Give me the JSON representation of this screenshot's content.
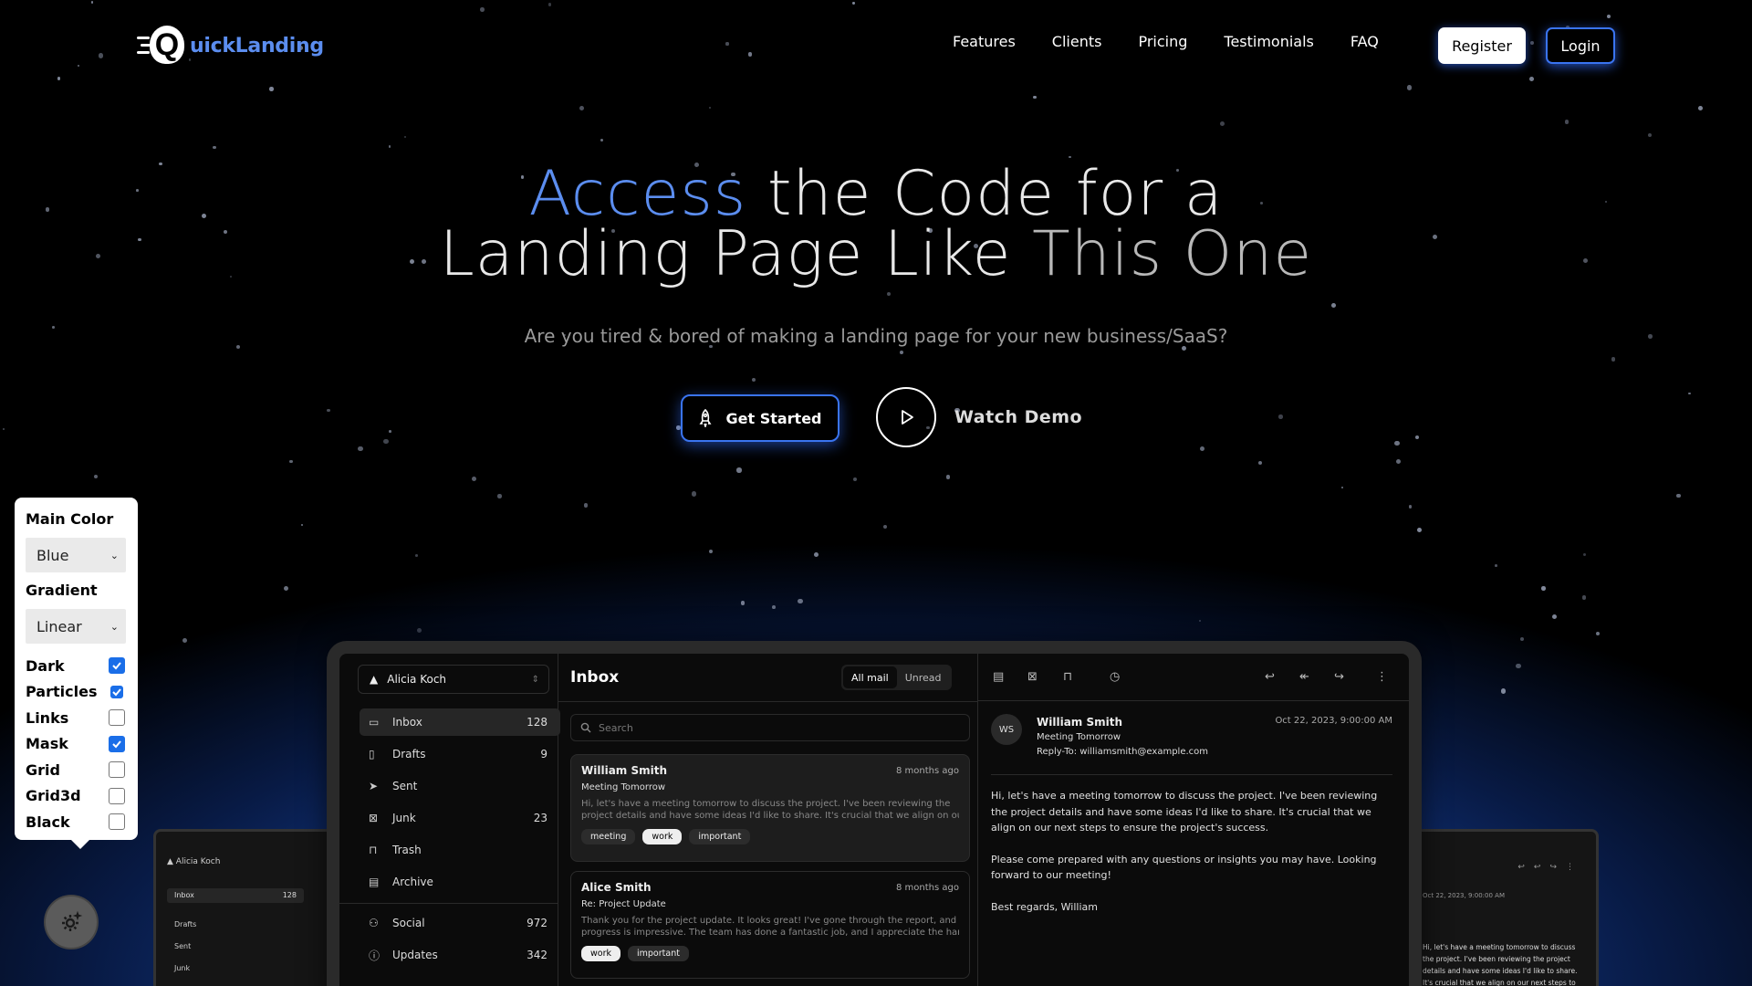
{
  "brand": {
    "logo_letter": "Q",
    "name": "uickLanding",
    "accent": "#5b8def"
  },
  "nav": {
    "links": [
      "Features",
      "Clients",
      "Pricing",
      "Testimonials",
      "FAQ"
    ],
    "register": "Register",
    "login": "Login"
  },
  "hero": {
    "title_accent": "Access",
    "title_rest_1": " the Code for a",
    "title_line2_a": "Landing Page Like ",
    "title_line2_b": "This One",
    "subtitle": "Are you tired & bored of making a landing page for your new business/SaaS?",
    "cta_primary": "Get Started",
    "cta_secondary": "Watch Demo"
  },
  "settings": {
    "main_color_label": "Main Color",
    "main_color_value": "Blue",
    "gradient_label": "Gradient",
    "gradient_value": "Linear",
    "options": [
      {
        "label": "Dark",
        "checked": true
      },
      {
        "label": "Particles",
        "checked": true
      },
      {
        "label": "Links",
        "checked": false
      },
      {
        "label": "Mask",
        "checked": true
      },
      {
        "label": "Grid",
        "checked": false
      },
      {
        "label": "Grid3d",
        "checked": false
      },
      {
        "label": "Black",
        "checked": false
      }
    ],
    "gear_icon": "gear-sparkle-icon"
  },
  "mockup": {
    "account": "Alicia Koch",
    "folders": [
      {
        "label": "Inbox",
        "count": "128",
        "icon": "inbox-icon"
      },
      {
        "label": "Drafts",
        "count": "9",
        "icon": "file-icon"
      },
      {
        "label": "Sent",
        "count": "",
        "icon": "send-icon"
      },
      {
        "label": "Junk",
        "count": "23",
        "icon": "archive-x-icon"
      },
      {
        "label": "Trash",
        "count": "",
        "icon": "trash-icon"
      },
      {
        "label": "Archive",
        "count": "",
        "icon": "archive-icon"
      },
      {
        "label": "Social",
        "count": "972",
        "icon": "users-icon"
      },
      {
        "label": "Updates",
        "count": "342",
        "icon": "alert-circle-icon"
      }
    ],
    "inbox_title": "Inbox",
    "tabs": [
      "All mail",
      "Unread"
    ],
    "search_placeholder": "Search",
    "mails": [
      {
        "from": "William Smith",
        "ago": "8 months ago",
        "subject": "Meeting Tomorrow",
        "preview1": "Hi, let's have a meeting tomorrow to discuss the project. I've been reviewing the",
        "preview2": "project details and have some ideas I'd like to share. It's crucial that we align on our...",
        "labels": [
          "meeting",
          "work",
          "important"
        ]
      },
      {
        "from": "Alice Smith",
        "ago": "8 months ago",
        "subject": "Re: Project Update",
        "preview1": "Thank you for the project update. It looks great! I've gone through the report, and the",
        "preview2": "progress is impressive. The team has done a fantastic job, and I appreciate the hard...",
        "labels": [
          "work",
          "important"
        ]
      }
    ],
    "message": {
      "initials": "WS",
      "from": "William Smith",
      "subject": "Meeting Tomorrow",
      "reply_to": "Reply-To: williamsmith@example.com",
      "date": "Oct 22, 2023, 9:00:00 AM",
      "p1": "Hi, let's have a meeting tomorrow to discuss the project. I've been reviewing the project details and have some ideas I'd like to share. It's crucial that we align on our next steps to ensure the project's success.",
      "p2": "Please come prepared with any questions or insights you may have. Looking forward to our meeting!",
      "p3": "Best regards, William"
    }
  }
}
